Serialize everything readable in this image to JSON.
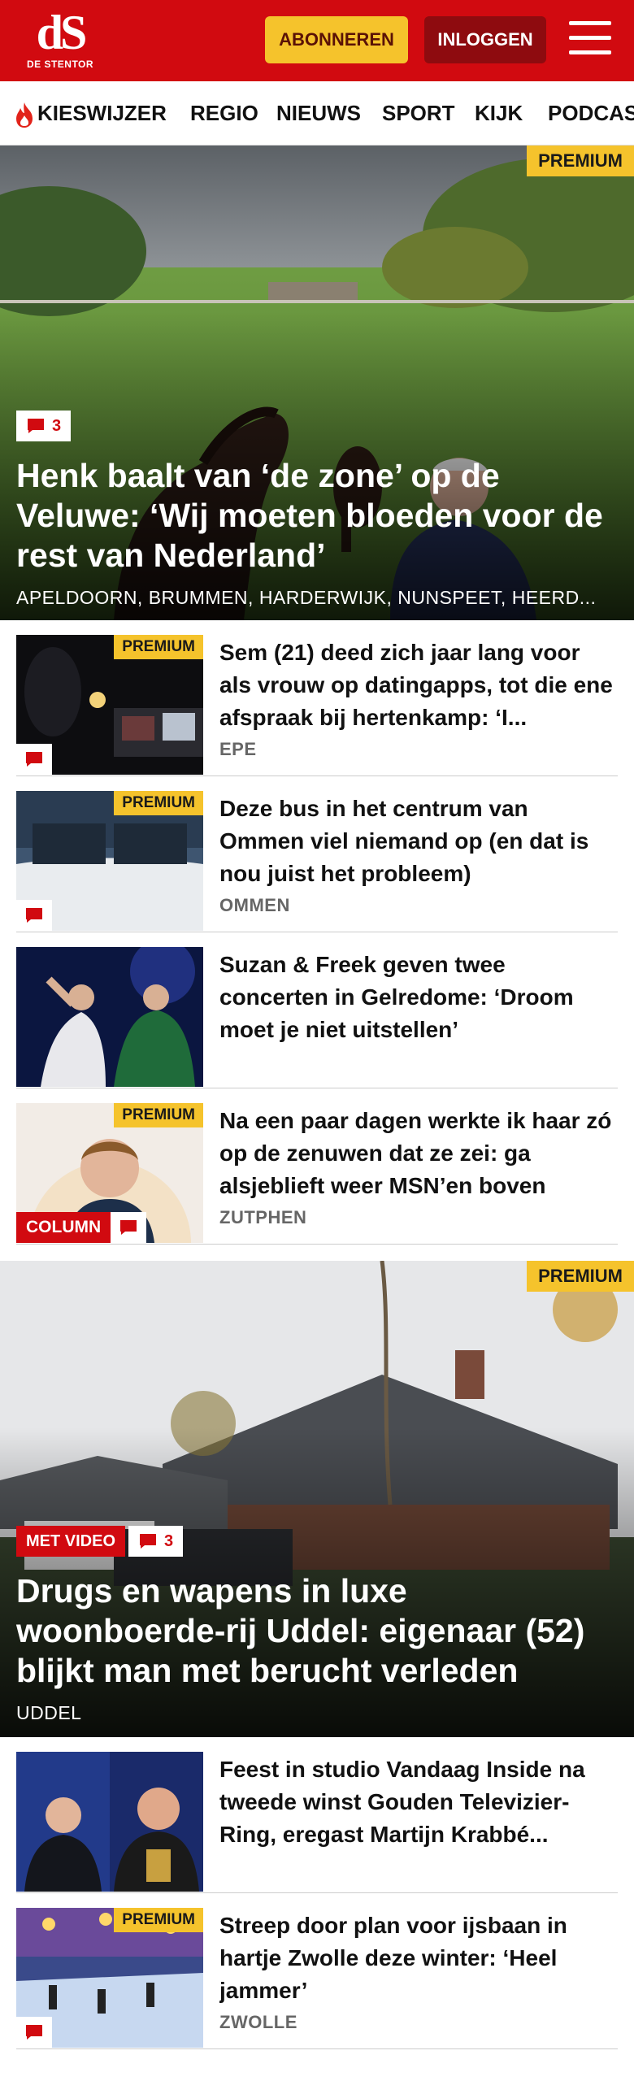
{
  "header": {
    "logo_mark": "dS",
    "logo_text": "DE STENTOR",
    "subscribe_label": "ABONNEREN",
    "login_label": "INLOGGEN"
  },
  "nav": {
    "items": [
      "KIESWIJZER",
      "REGIO",
      "NIEUWS",
      "SPORT",
      "KIJK",
      "PODCAS"
    ]
  },
  "premium_label": "PREMIUM",
  "hero1": {
    "comments": "3",
    "title": "Henk baalt van ‘de zone’ op de Veluwe: ‘Wij moeten bloeden voor de rest van Nederland’",
    "locations": "APELDOORN, BRUMMEN, HARDERWIJK, NUNSPEET, HEERD..."
  },
  "articles1": [
    {
      "title": "Sem (21) deed zich jaar lang voor als vrouw op datingapps, tot die ene afspraak bij hertenkamp: ‘I...",
      "location": "EPE"
    },
    {
      "title": "Deze bus in het centrum van Ommen viel niemand op (en dat is nou juist het probleem)",
      "location": "OMMEN"
    },
    {
      "title": "Suzan & Freek geven twee concerten in Gelredome: ‘Droom moet je niet uitstellen’",
      "location": ""
    },
    {
      "title": "Na een paar dagen werkte ik haar zó op de zenuwen dat ze zei: ga alsjeblieft weer MSN’en boven",
      "location": "ZUTPHEN",
      "column_label": "COLUMN"
    }
  ],
  "hero2": {
    "video_label": "MET VIDEO",
    "comments": "3",
    "title": "Drugs en wapens in luxe woonboerde-rij Uddel: eigenaar (52) blijkt man met berucht verleden",
    "locations": "UDDEL"
  },
  "articles2": [
    {
      "title": "Feest in studio Vandaag Inside na tweede winst Gouden Televizier-Ring, eregast Martijn Krabbé...",
      "location": ""
    },
    {
      "title": "Streep door plan voor ijsbaan in hartje Zwolle deze winter: ‘Heel jammer’",
      "location": "ZWOLLE"
    }
  ],
  "colors": {
    "brand_red": "#d10a10",
    "premium_yellow": "#f5c32c",
    "login_dark_red": "#8e0b0f"
  }
}
